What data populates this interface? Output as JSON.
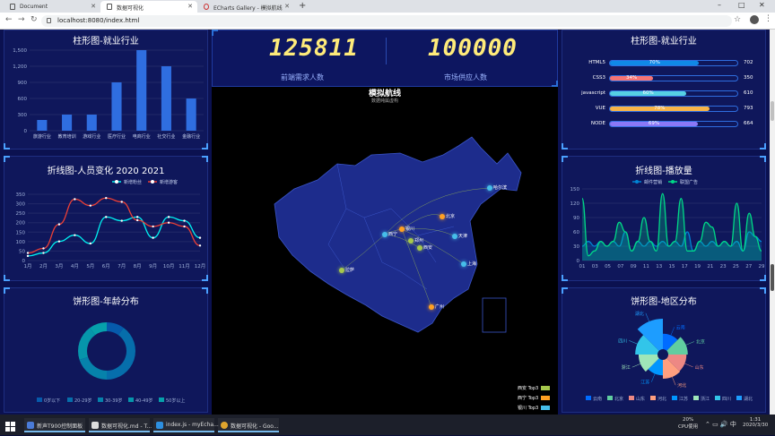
{
  "browser": {
    "tabs": [
      {
        "label": "Document",
        "active": false
      },
      {
        "label": "数据可视化",
        "active": true
      },
      {
        "label": "ECharts Gallery - 模拟航线",
        "active": false
      }
    ],
    "url": "localhost:8080/index.html",
    "window_controls": [
      "–",
      "□",
      "✕"
    ]
  },
  "dashboard": {
    "counter_left": "125811",
    "counter_right": "100000",
    "label_left": "前端需求人数",
    "label_right": "市场供应人数",
    "map_title": "模拟航线",
    "map_subtitle": "数据纯属虚构",
    "map_legend": [
      {
        "label": "西安 Top3",
        "color": "#a6c84c"
      },
      {
        "label": "西宁 Top3",
        "color": "#ffa022"
      },
      {
        "label": "银川 Top3",
        "color": "#46bee9"
      }
    ],
    "cities": [
      "哈尔滨",
      "北京",
      "银川",
      "西宁",
      "拉萨",
      "西安",
      "上海",
      "广州",
      "天津",
      "郑州"
    ]
  },
  "panel_bar": {
    "title": "柱形图-就业行业"
  },
  "panel_line": {
    "title": "折线图-人员变化   2020   2021",
    "legend": [
      "新增粉丝",
      "新增游客"
    ]
  },
  "panel_pie": {
    "title": "饼形图-年龄分布",
    "legend": [
      "0岁以下",
      "20-29岁",
      "30-39岁",
      "40-49岁",
      "50岁以上"
    ]
  },
  "panel_hbar": {
    "title": "柱形图-就业行业"
  },
  "panel_play": {
    "title": "折线图-播放量",
    "legend": [
      "邮件营销",
      "联盟广告"
    ]
  },
  "panel_region": {
    "title": "饼形图-地区分布",
    "legend": [
      "云南",
      "北京",
      "山东",
      "河北",
      "江苏",
      "浙江",
      "四川",
      "湖北"
    ],
    "slice_labels": [
      "云南",
      "北京",
      "山东",
      "河北",
      "江苏",
      "浙江",
      "四川",
      "湖北"
    ]
  },
  "chart_data": [
    {
      "type": "bar",
      "title": "柱形图-就业行业",
      "categories": [
        "旅游行业",
        "教育培训",
        "游戏行业",
        "医疗行业",
        "电商行业",
        "社交行业",
        "金融行业"
      ],
      "values": [
        200,
        300,
        300,
        900,
        1500,
        1200,
        600
      ],
      "ylim": [
        0,
        1500
      ],
      "yticks": [
        "0",
        "300",
        "600",
        "900",
        "1,200",
        "1,500"
      ],
      "color": "#2f6ee0"
    },
    {
      "type": "line",
      "title": "折线图-人员变化",
      "categories": [
        "1月",
        "2月",
        "3月",
        "4月",
        "5月",
        "6月",
        "7月",
        "8月",
        "9月",
        "10月",
        "11月",
        "12月"
      ],
      "series": [
        {
          "name": "新增粉丝",
          "values": [
            24,
            40,
            101,
            134,
            90,
            230,
            210,
            230,
            120,
            230,
            210,
            120
          ],
          "color": "#00f2f1"
        },
        {
          "name": "新增游客",
          "values": [
            40,
            64,
            191,
            324,
            290,
            330,
            310,
            213,
            180,
            200,
            180,
            79
          ],
          "color": "#ed3f35"
        }
      ],
      "ylim": [
        0,
        350
      ],
      "yticks": [
        "0",
        "50",
        "100",
        "150",
        "200",
        "250",
        "300",
        "350"
      ]
    },
    {
      "type": "pie",
      "title": "饼形图-年龄分布",
      "categories": [
        "0岁以下",
        "20-29岁",
        "30-39岁",
        "40-49岁",
        "50岁以上"
      ],
      "values": [
        1,
        4,
        2,
        2,
        1
      ],
      "colors": [
        "#065aab",
        "#066eab",
        "#0682ab",
        "#0696ab",
        "#06a0ab"
      ]
    },
    {
      "type": "bar",
      "title": "柱形图-就业行业",
      "categories": [
        "HTML5",
        "CSS3",
        "javascript",
        "VUE",
        "NODE"
      ],
      "percent": [
        70,
        34,
        60,
        78,
        69
      ],
      "totals": [
        702,
        350,
        610,
        793,
        664
      ],
      "percent_labels": [
        "70%",
        "34%",
        "60%",
        "78%",
        "69%"
      ],
      "total_labels": [
        "702",
        "350",
        "610",
        "793",
        "664"
      ],
      "colors": [
        "#1089E7",
        "#F57474",
        "#56D0E3",
        "#F8B448",
        "#8B78F6"
      ]
    },
    {
      "type": "line",
      "title": "折线图-播放量",
      "x": [
        "01",
        "03",
        "05",
        "07",
        "09",
        "11",
        "13",
        "15",
        "17",
        "19",
        "21",
        "23",
        "25",
        "27",
        "29"
      ],
      "series": [
        {
          "name": "邮件营销",
          "values": [
            30,
            40,
            30,
            40,
            30,
            40,
            30,
            60,
            20,
            40,
            30,
            40,
            30,
            40,
            30,
            40,
            30,
            60,
            20,
            40,
            30,
            40,
            30,
            40,
            30,
            40,
            20,
            60,
            50,
            40
          ],
          "color": "#0184d5"
        },
        {
          "name": "联盟广告",
          "values": [
            130,
            10,
            20,
            40,
            30,
            40,
            80,
            60,
            20,
            40,
            90,
            40,
            20,
            140,
            30,
            40,
            130,
            20,
            20,
            40,
            80,
            70,
            30,
            40,
            30,
            120,
            20,
            99,
            50,
            20
          ],
          "color": "#00d887"
        }
      ],
      "ylim": [
        0,
        150
      ],
      "yticks": [
        "0",
        "30",
        "60",
        "90",
        "120",
        "150"
      ]
    },
    {
      "type": "pie",
      "title": "饼形图-地区分布",
      "categories": [
        "云南",
        "北京",
        "山东",
        "河北",
        "江苏",
        "浙江",
        "四川",
        "湖北"
      ],
      "values": [
        20,
        26,
        24,
        25,
        20,
        25,
        30,
        42
      ],
      "colors": [
        "#006cff",
        "#60cda0",
        "#ed8884",
        "#ff9f7f",
        "#0096ff",
        "#9fe6b8",
        "#32c5e9",
        "#1d9dff"
      ]
    }
  ],
  "taskbar": {
    "items": [
      "新声T900控制面板",
      "数据可视化.md - T...",
      "index.js - myEcha...",
      "数据可视化 - Goo..."
    ],
    "cpu": "20%",
    "cpu_label": "CPU使用",
    "time": "1:31",
    "date": "2020/3/30"
  }
}
